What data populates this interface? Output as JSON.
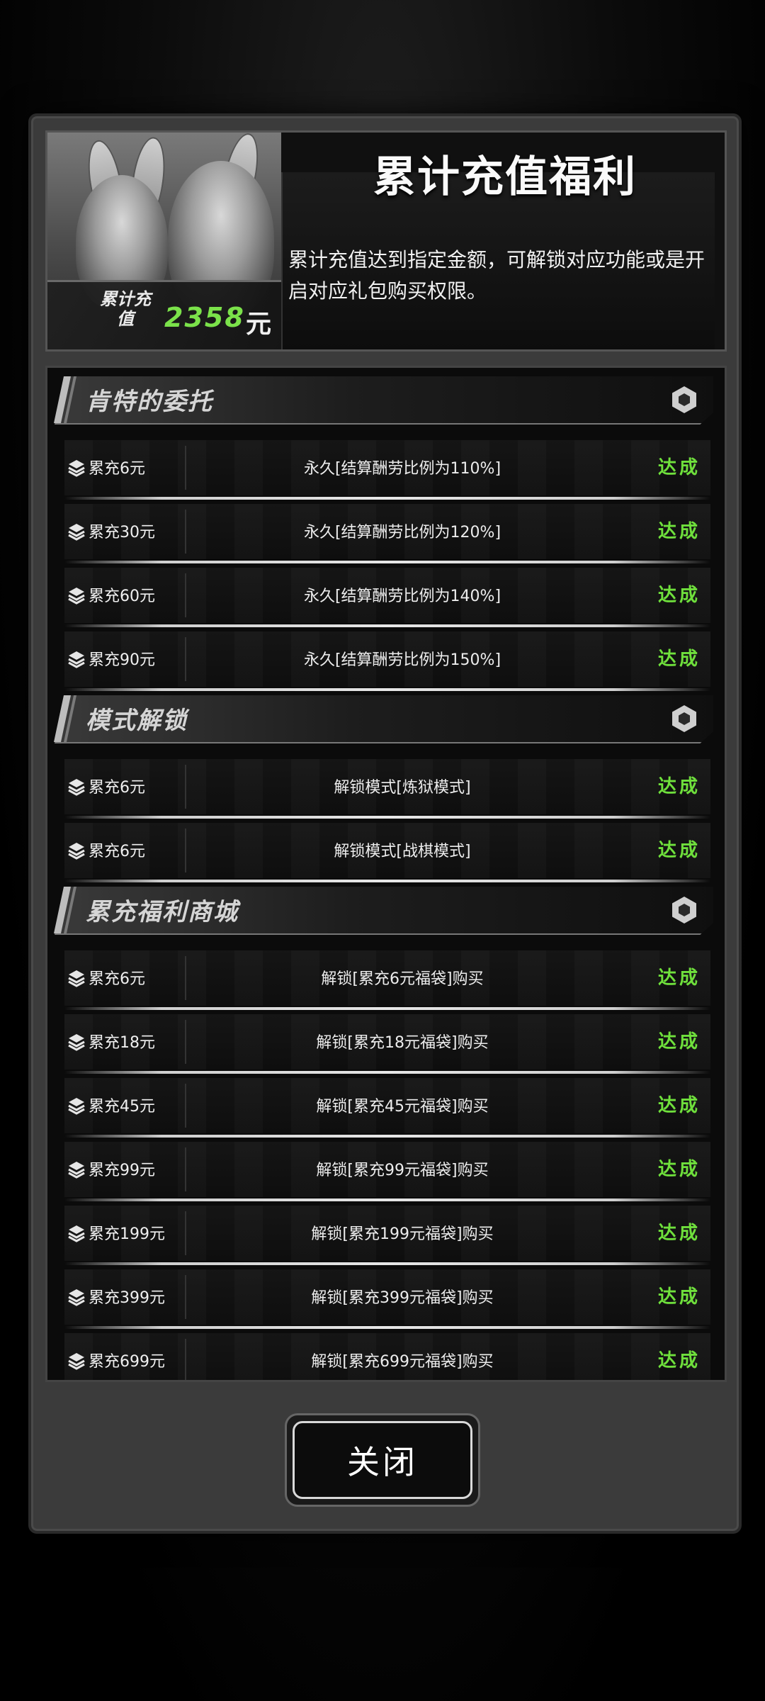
{
  "header": {
    "title": "累计充值福利",
    "description": "累计充值达到指定金额，可解锁对应功能或是开启对应礼包购买权限。",
    "total_label": "累计充值",
    "total_value": "2358",
    "total_unit": "元"
  },
  "colors": {
    "accent_green": "#6fe03c",
    "panel_gray": "#3b3b3b",
    "panel_dark": "#0b0b0b"
  },
  "sections": [
    {
      "title": "肯特的委托",
      "icon": "hexagon-icon",
      "rows": [
        {
          "amount": "累充6元",
          "reward": "永久[结算酬劳比例为110%]",
          "status": "达成"
        },
        {
          "amount": "累充30元",
          "reward": "永久[结算酬劳比例为120%]",
          "status": "达成"
        },
        {
          "amount": "累充60元",
          "reward": "永久[结算酬劳比例为140%]",
          "status": "达成"
        },
        {
          "amount": "累充90元",
          "reward": "永久[结算酬劳比例为150%]",
          "status": "达成"
        }
      ]
    },
    {
      "title": "模式解锁",
      "icon": "hexagon-icon",
      "rows": [
        {
          "amount": "累充6元",
          "reward": "解锁模式[炼狱模式]",
          "status": "达成"
        },
        {
          "amount": "累充6元",
          "reward": "解锁模式[战棋模式]",
          "status": "达成"
        }
      ]
    },
    {
      "title": "累充福利商城",
      "icon": "hexagon-icon",
      "rows": [
        {
          "amount": "累充6元",
          "reward": "解锁[累充6元福袋]购买",
          "status": "达成"
        },
        {
          "amount": "累充18元",
          "reward": "解锁[累充18元福袋]购买",
          "status": "达成"
        },
        {
          "amount": "累充45元",
          "reward": "解锁[累充45元福袋]购买",
          "status": "达成"
        },
        {
          "amount": "累充99元",
          "reward": "解锁[累充99元福袋]购买",
          "status": "达成"
        },
        {
          "amount": "累充199元",
          "reward": "解锁[累充199元福袋]购买",
          "status": "达成"
        },
        {
          "amount": "累充399元",
          "reward": "解锁[累充399元福袋]购买",
          "status": "达成"
        },
        {
          "amount": "累充699元",
          "reward": "解锁[累充699元福袋]购买",
          "status": "达成"
        }
      ]
    }
  ],
  "footer": {
    "close_label": "关闭"
  }
}
